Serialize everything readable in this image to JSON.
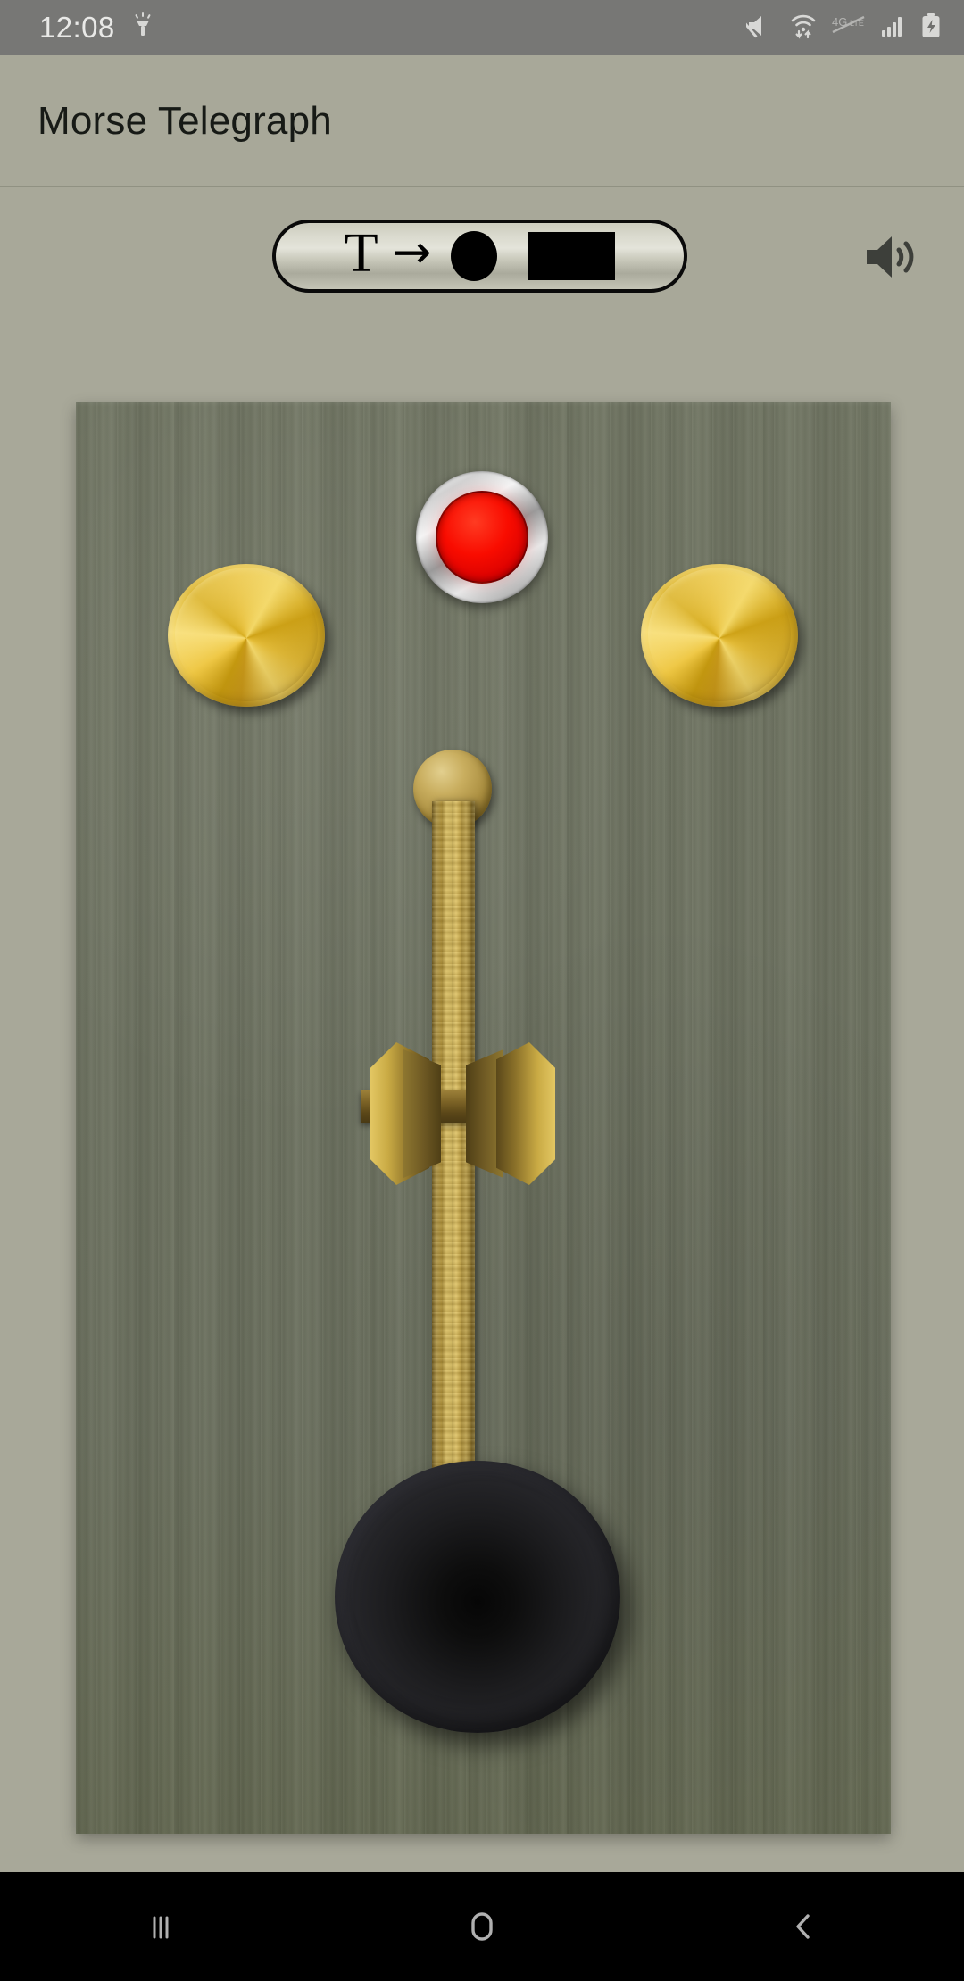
{
  "status_bar": {
    "clock": "12:08",
    "left_icons": [
      {
        "name": "flashlight-icon"
      }
    ],
    "right_icons": [
      {
        "name": "volume-mute-icon"
      },
      {
        "name": "wifi-transfer-icon"
      },
      {
        "name": "lte-disabled-icon"
      },
      {
        "name": "cellular-signal-icon"
      },
      {
        "name": "battery-charging-icon"
      }
    ]
  },
  "app_bar": {
    "title": "Morse Telegraph"
  },
  "controls": {
    "mode_toggle": {
      "name": "text-to-morse-toggle",
      "text_label": "T",
      "arrow": "→",
      "dot": "●",
      "dash": "▬",
      "meaning": "Text to Morse"
    },
    "speaker": {
      "name": "sound-on-icon",
      "state": "on"
    }
  },
  "telegraph": {
    "board": {
      "name": "telegraph-wood-board",
      "color": "#6e7361"
    },
    "lamp": {
      "name": "signal-lamp",
      "state": "on",
      "color": "#f90c00",
      "bezel_color": "#d2d2d2"
    },
    "terminals": [
      {
        "name": "brass-terminal-left",
        "color": "#e9c23f"
      },
      {
        "name": "brass-terminal-right",
        "color": "#e9c23f"
      }
    ],
    "key_lever": {
      "name": "telegraph-key-lever",
      "ball_color": "#c9ae5f",
      "shaft_color": "#cdac49",
      "pivot_color": "#8a7029",
      "knob_color": "#1b1b1d"
    }
  },
  "nav_bar": {
    "buttons": [
      {
        "name": "recents-button",
        "glyph": "|||"
      },
      {
        "name": "home-button",
        "glyph": "▢"
      },
      {
        "name": "back-button",
        "glyph": "‹"
      }
    ],
    "color": "#b0b0b0"
  },
  "colors": {
    "page_background": "#a8a899",
    "status_bar": "#777775",
    "title_text": "#171a16",
    "board": "#6e7361",
    "lamp_red": "#f90c00",
    "brass": "#e9c23f",
    "bakelite": "#1b1b1d",
    "nav_background": "#000000"
  }
}
